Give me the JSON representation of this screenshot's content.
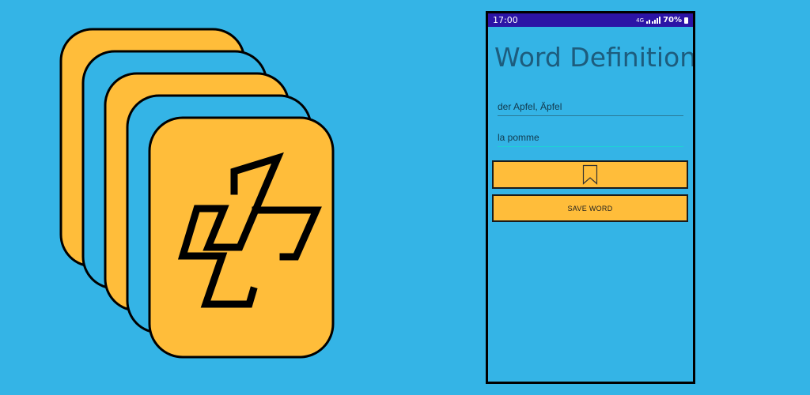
{
  "colors": {
    "background": "#34b4e6",
    "card_fill": "#ffbd3a",
    "card_outline": "#000000",
    "status_bar": "#2c14a6",
    "title_text": "#1d5c7d"
  },
  "status_bar": {
    "time": "17:00",
    "network_label": "4G",
    "battery": "70%"
  },
  "screen": {
    "title": "Word Definition",
    "word_field_value": "der Apfel, Äpfel",
    "translation_field_value": "la pomme",
    "bookmark_icon": "bookmark-icon",
    "save_button_label": "SAVE WORD"
  }
}
